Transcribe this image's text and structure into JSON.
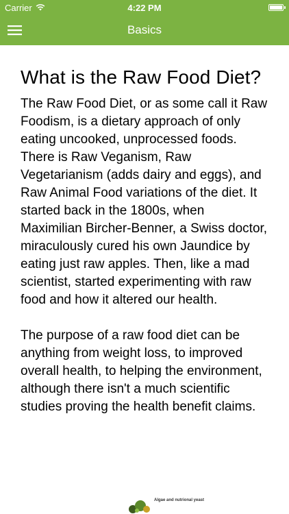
{
  "status_bar": {
    "carrier": "Carrier",
    "time": "4:22 PM",
    "wifi_icon": "wifi-icon",
    "battery_icon": "battery-icon"
  },
  "nav_bar": {
    "title": "Basics",
    "menu_icon": "hamburger-menu-icon"
  },
  "article": {
    "title": "What is the Raw Food Diet?",
    "paragraphs": [
      "The Raw Food Diet, or as some call it Raw Foodism, is a dietary approach of only eating uncooked, unprocessed foods. There is Raw Veganism, Raw Vegetarianism (adds dairy and eggs), and Raw Animal Food variations of the diet. It started back in the 1800s, when Maximilian Bircher-Benner, a Swiss doctor, miraculously cured his own Jaundice by eating just raw apples. Then, like a mad scientist, started experimenting with raw food and how it altered our health.",
      "The purpose of a raw food diet can be anything from weight loss, to improved overall health, to helping the environment, although there isn't a much scientific studies proving the health benefit claims."
    ]
  },
  "ad": {
    "text": "Algae and nutrional yeast"
  },
  "colors": {
    "brand_green": "#7cb342",
    "text": "#000000",
    "background": "#ffffff"
  }
}
